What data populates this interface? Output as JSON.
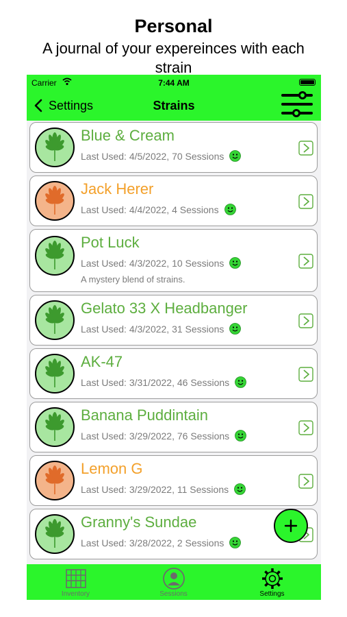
{
  "promo": {
    "title": "Personal",
    "subtitle": "A journal of your expereinces with each strain"
  },
  "status_bar": {
    "carrier": "Carrier",
    "time": "7:44 AM"
  },
  "navbar": {
    "back_label": "Settings",
    "title": "Strains",
    "filter_icon": "sliders-icon",
    "background": "#2bf52b"
  },
  "strains": [
    {
      "name": "Blue & Cream",
      "last_used": "Last Used: 4/5/2022, 70 Sessions",
      "note": "",
      "leaf_color": "green"
    },
    {
      "name": "Jack Herer",
      "last_used": "Last Used: 4/4/2022, 4 Sessions",
      "note": "",
      "leaf_color": "orange"
    },
    {
      "name": "Pot Luck",
      "last_used": "Last Used: 4/3/2022, 10 Sessions",
      "note": "A mystery blend of strains.",
      "leaf_color": "green"
    },
    {
      "name": "Gelato 33 X Headbanger",
      "last_used": "Last Used: 4/3/2022, 31 Sessions",
      "note": "",
      "leaf_color": "green"
    },
    {
      "name": "AK-47",
      "last_used": "Last Used: 3/31/2022, 46 Sessions",
      "note": "",
      "leaf_color": "green"
    },
    {
      "name": "Banana Puddintain",
      "last_used": "Last Used: 3/29/2022, 76 Sessions",
      "note": "",
      "leaf_color": "green"
    },
    {
      "name": "Lemon G",
      "last_used": "Last Used: 3/29/2022, 11 Sessions",
      "note": "",
      "leaf_color": "orange"
    },
    {
      "name": "Granny's Sundae",
      "last_used": "Last Used: 3/28/2022, 2 Sessions",
      "note": "",
      "leaf_color": "green"
    }
  ],
  "colors": {
    "green_name": "#5dae3f",
    "orange_name": "#f3a02a",
    "green_leaf": "#3d9a2e",
    "green_leaf_bg": "#a8e6a0",
    "orange_leaf": "#e06b2a",
    "orange_leaf_bg": "#f4b48a",
    "smiley": "#35d435"
  },
  "fab": {
    "icon": "plus-icon"
  },
  "tabbar": {
    "tabs": [
      {
        "label": "Inventory",
        "icon": "grid-icon"
      },
      {
        "label": "Sessions",
        "icon": "person-circle-icon"
      },
      {
        "label": "Settings",
        "icon": "gear-icon"
      }
    ],
    "active": "Settings"
  }
}
